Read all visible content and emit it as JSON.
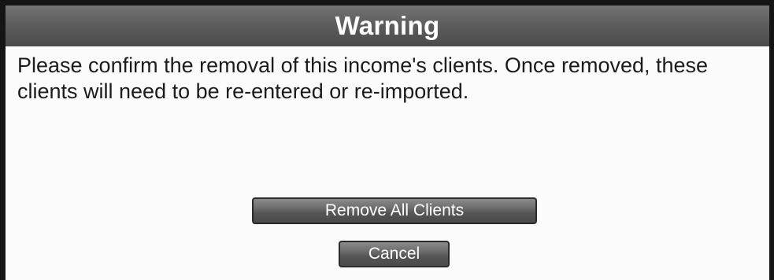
{
  "dialog": {
    "title": "Warning",
    "message": "Please confirm the removal of this income's clients. Once removed, these clients will need to be re-entered or re-imported.",
    "remove_label": "Remove All Clients",
    "cancel_label": "Cancel"
  },
  "colors": {
    "title_bar": "#5e5e5e",
    "button": "#6c6c6c",
    "border": "#151515",
    "text": "#1c1c1c"
  }
}
